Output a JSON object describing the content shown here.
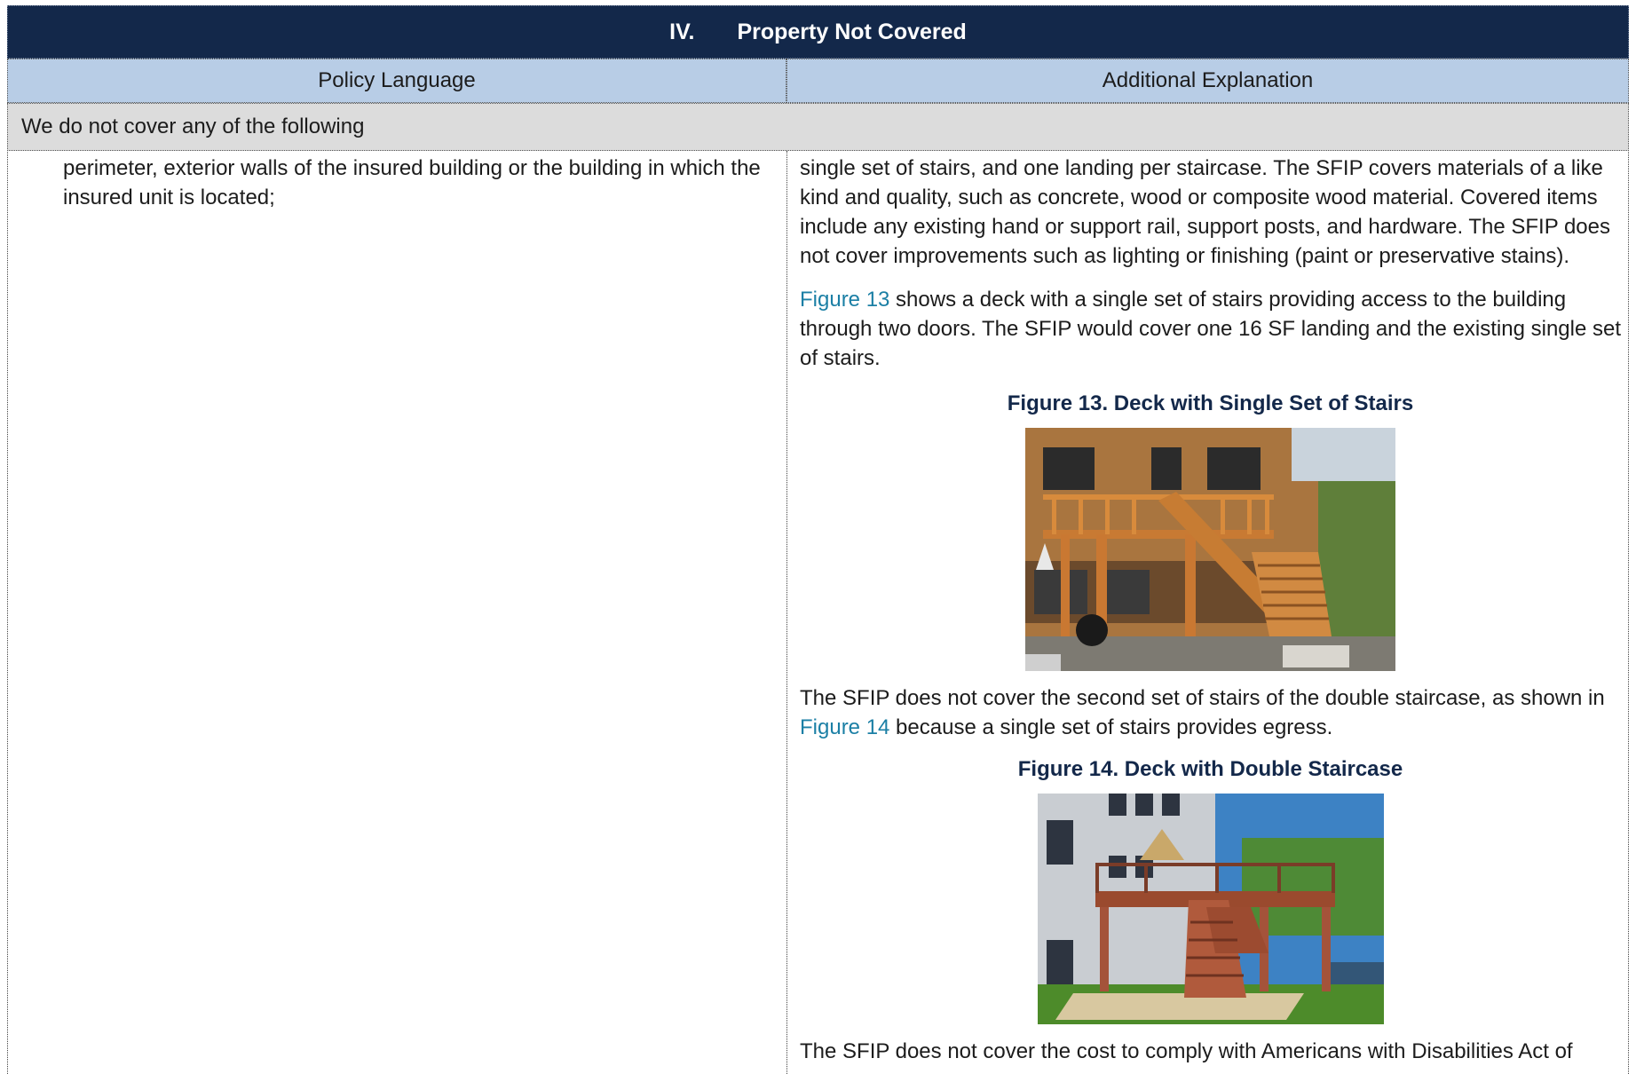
{
  "header": {
    "section_number": "IV.",
    "section_title": "Property Not Covered"
  },
  "columns": {
    "left": "Policy Language",
    "right": "Additional Explanation"
  },
  "subheading": "We do not cover any of the following",
  "policy_text": "perimeter, exterior walls of the insured building or the building in which the insured unit is located;",
  "explanation": {
    "p1": "single set of stairs, and one landing per staircase. The SFIP covers materials of a like kind and quality, such as concrete, wood or composite wood material. Covered items include any existing hand or support rail, support posts, and hardware. The SFIP does not cover improvements such as lighting or finishing (paint or preservative stains).",
    "p2_link": "Figure 13",
    "p2_rest": " shows a deck with a single set of stairs providing access to the building through two doors. The SFIP would cover one 16 SF landing and the existing single set of stairs.",
    "fig13_title": "Figure 13. Deck with Single Set of Stairs",
    "p3_start": "The SFIP does not cover the second set of stairs of the double staircase, as shown in ",
    "p3_link": "Figure 14",
    "p3_rest": " because a single set of stairs provides egress.",
    "fig14_title": "Figure 14. Deck with Double Staircase",
    "p4": "The SFIP does not cover the cost to comply with Americans with Disabilities Act of"
  },
  "colors": {
    "title_bar": "#13284a",
    "column_header": "#b8cde6",
    "subheading_bg": "#dcdcdc",
    "link": "#1b7fa5"
  }
}
